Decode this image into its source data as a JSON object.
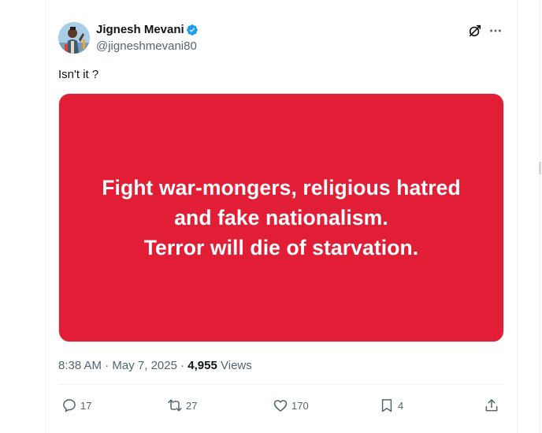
{
  "author": {
    "name": "Jignesh Mevani",
    "handle": "@jigneshmevani80",
    "verified": true
  },
  "tweet": {
    "text": "Isn't it ?",
    "image_text_lines": [
      "Fight war-mongers, religious hatred",
      "and fake nationalism.",
      "Terror will die of starvation."
    ],
    "image_background": "#e21d36"
  },
  "meta": {
    "time": "8:38 AM",
    "sep1": " · ",
    "date": "May 7, 2025",
    "sep2": " · ",
    "views_count": "4,955",
    "views_label": " Views"
  },
  "actions": {
    "replies": "17",
    "reposts": "27",
    "likes": "170",
    "bookmarks": "4"
  },
  "icons": [
    "grok-icon",
    "more-icon",
    "verified-badge-icon",
    "reply-icon",
    "repost-icon",
    "like-icon",
    "bookmark-icon",
    "share-icon"
  ],
  "colors": {
    "accent": "#1d9bf0",
    "text": "#0f1419",
    "secondary": "#536471"
  }
}
